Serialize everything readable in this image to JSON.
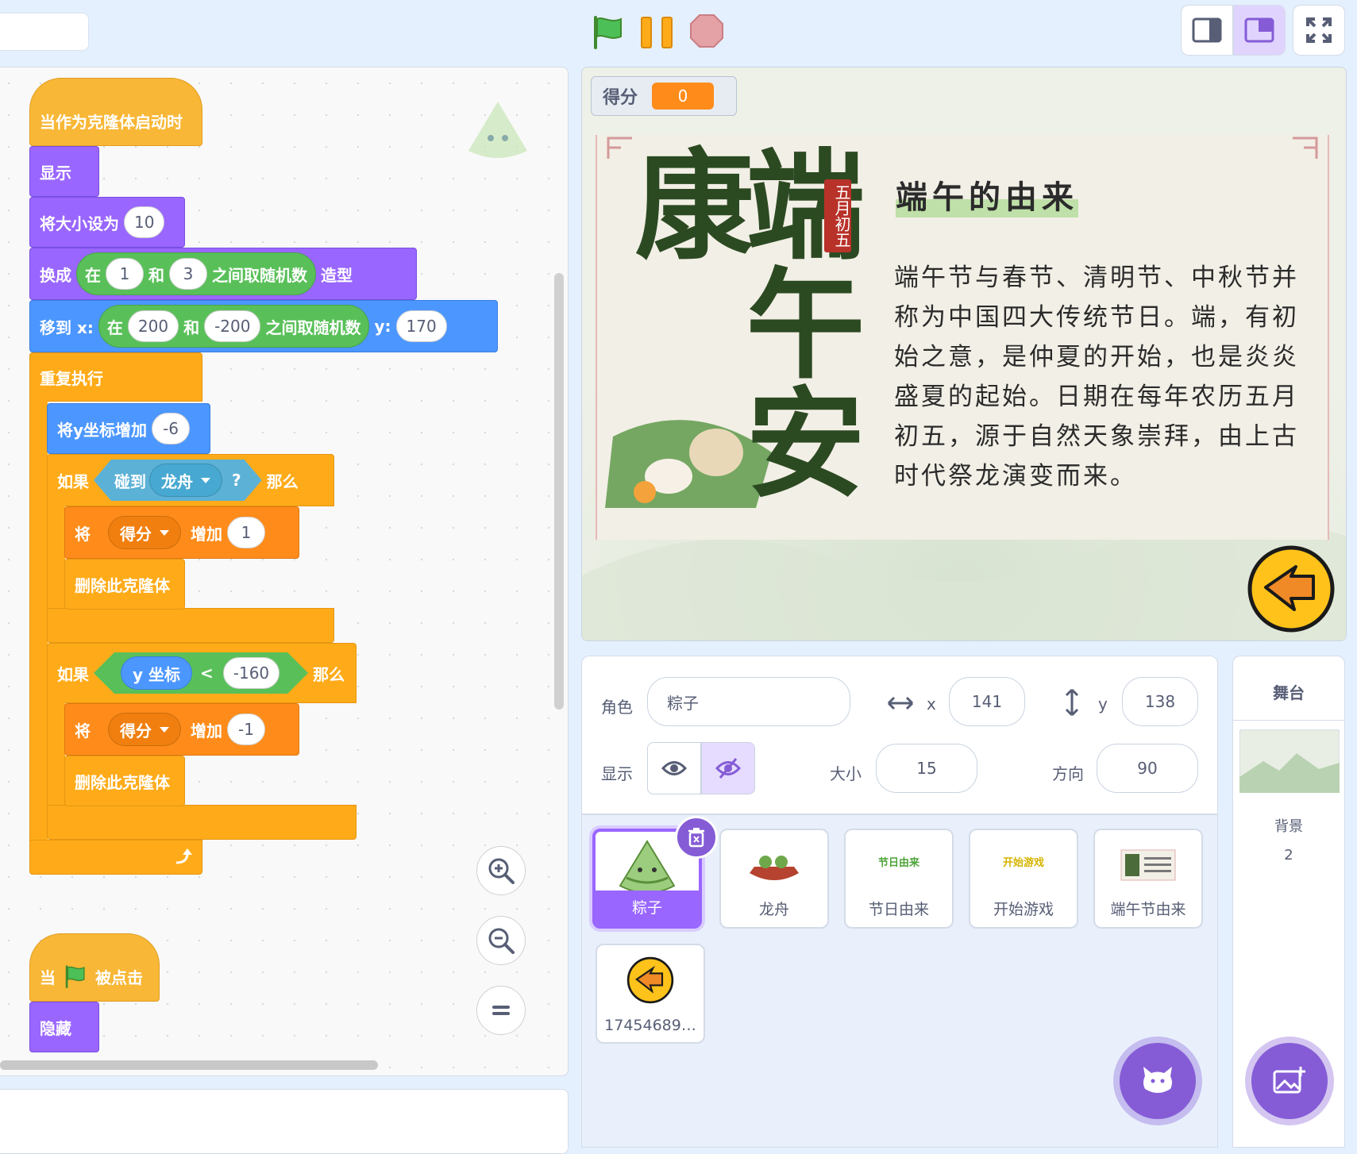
{
  "colors": {
    "events": "#f8b736",
    "looks": "#9966ff",
    "motion": "#4c97ff",
    "control": "#ffab19",
    "variables": "#ff8c1a",
    "operators": "#59c059",
    "sensing": "#5cb1d6",
    "accent": "#855cd6"
  },
  "topbar": {
    "flag_icon": "green-flag-icon",
    "pause_icon": "pause-icon",
    "stop_icon": "stop-icon"
  },
  "script1": {
    "hat": "当作为克隆体启动时",
    "show": "显示",
    "set_size": {
      "label": "将大小设为",
      "value": "10"
    },
    "switch_costume": {
      "label": "换成",
      "rand_in": "在",
      "from": "1",
      "and": "和",
      "to": "3",
      "rand_label": "之间取随机数",
      "suffix": "造型"
    },
    "goto": {
      "label": "移到 x:",
      "rand_in": "在",
      "from": "200",
      "and": "和",
      "to": "-200",
      "rand_label": "之间取随机数",
      "y_label": "y:",
      "y": "170"
    },
    "forever": "重复执行",
    "change_y": {
      "label": "将y坐标增加",
      "value": "-6"
    },
    "if1": {
      "if": "如果",
      "touch": "碰到",
      "target": "龙舟",
      "q": "?",
      "then": "那么"
    },
    "change_score1": {
      "label": "将",
      "var": "得分",
      "by": "增加",
      "value": "1"
    },
    "delete1": "删除此克隆体",
    "if2": {
      "if": "如果",
      "reporter": "y 坐标",
      "op": "<",
      "value": "-160",
      "then": "那么"
    },
    "change_score2": {
      "label": "将",
      "var": "得分",
      "by": "增加",
      "value": "-1"
    },
    "delete2": "删除此克隆体"
  },
  "script2": {
    "when": "当",
    "clicked": "被点击",
    "hide": "隐藏"
  },
  "stage": {
    "monitor_label": "得分",
    "monitor_value": "0",
    "poster_title": "端午的由来",
    "poster_side": "五月初五",
    "poster_calligraphy": "端午安康",
    "poster_body": "端午节与春节、清明节、中秋节并称为中国四大传统节日。端，有初始之意，是仲夏的开始，也是炎炎盛夏的起始。日期在每年农历五月初五，源于自然天象崇拜，由上古时代祭龙演变而来。"
  },
  "sprite_info": {
    "sprite_label": "角色",
    "sprite_name": "粽子",
    "x_label": "x",
    "x": "141",
    "y_label": "y",
    "y": "138",
    "show_label": "显示",
    "size_label": "大小",
    "size": "15",
    "direction_label": "方向",
    "direction": "90"
  },
  "sprites": [
    {
      "name": "粽子",
      "selected": true
    },
    {
      "name": "龙舟",
      "selected": false
    },
    {
      "name": "节日由来",
      "selected": false,
      "thumb_text": "节日由来"
    },
    {
      "name": "开始游戏",
      "selected": false,
      "thumb_text": "开始游戏"
    },
    {
      "name": "端午节由来",
      "selected": false
    },
    {
      "name": "17454689…",
      "selected": false
    }
  ],
  "stage_panel": {
    "title": "舞台",
    "backdrops_label": "背景",
    "backdrops_count": "2"
  }
}
